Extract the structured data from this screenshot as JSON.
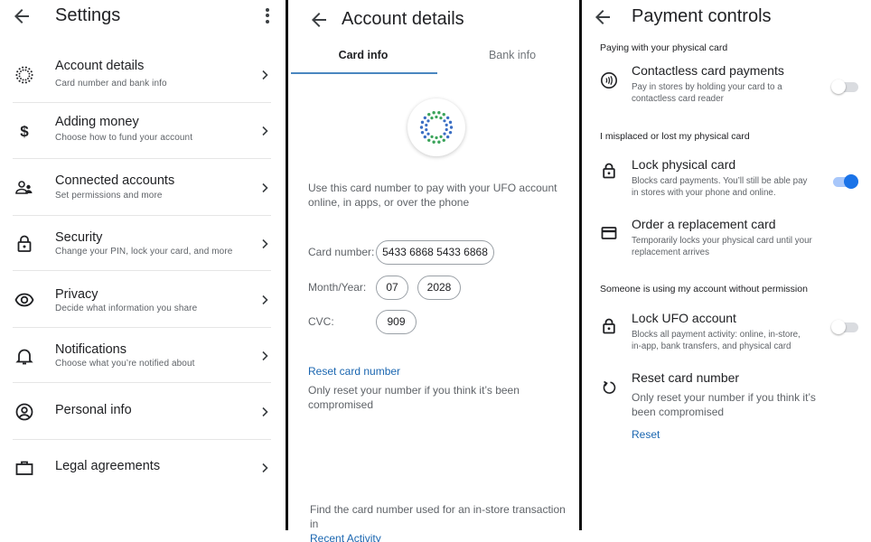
{
  "colors": {
    "link": "#1a66b0",
    "tab_indicator": "#4a86c0",
    "toggle_on": "#1a73e8",
    "logo_blue": "#3b6fc4",
    "logo_green": "#3aa35a"
  },
  "settings": {
    "title": "Settings",
    "back_icon": "arrow-left-icon",
    "more_icon": "more-vert-icon",
    "items": [
      {
        "icon": "ufo-logo-icon",
        "label": "Account details",
        "subtitle": "Card number and bank info"
      },
      {
        "icon": "dollar-icon",
        "label": "Adding money",
        "subtitle": "Choose how to fund your account"
      },
      {
        "icon": "people-icon",
        "label": "Connected accounts",
        "subtitle": "Set permissions and more"
      },
      {
        "icon": "lock-icon",
        "label": "Security",
        "subtitle": "Change your PIN, lock your card, and more"
      },
      {
        "icon": "eye-icon",
        "label": "Privacy",
        "subtitle": "Decide what information you share"
      },
      {
        "icon": "bell-icon",
        "label": "Notifications",
        "subtitle": "Choose what you’re notified about"
      },
      {
        "icon": "account-circle-icon",
        "label": "Personal info",
        "subtitle": ""
      },
      {
        "icon": "briefcase-icon",
        "label": "Legal agreements",
        "subtitle": ""
      }
    ]
  },
  "account_details": {
    "title": "Account details",
    "tabs": [
      {
        "label": "Card info",
        "active": true
      },
      {
        "label": "Bank info",
        "active": false
      }
    ],
    "description": "Use this card number to pay with your UFO account online, in apps, or over the phone",
    "fields": {
      "card_number_label": "Card number:",
      "card_number": "5433 6868 5433 6868",
      "month_year_label": "Month/Year:",
      "month": "07",
      "year": "2028",
      "cvc_label": "CVC:",
      "cvc": "909"
    },
    "reset_link": "Reset card number",
    "reset_note": "Only reset your number if you think it’s been compromised",
    "find_text": "Find the card number used for an in-store transaction in",
    "recent_activity_link": "Recent Activity"
  },
  "payment_controls": {
    "title": "Payment controls",
    "sections": [
      {
        "heading": "Paying with your physical card"
      },
      {
        "heading": "I misplaced or lost my physical card"
      },
      {
        "heading": "Someone is using my account without permission"
      }
    ],
    "controls": [
      {
        "icon": "contactless-icon",
        "label": "Contactless card payments",
        "subtitle": "Pay in stores by holding your card to a contactless card reader",
        "toggle": "off"
      },
      {
        "icon": "lock-icon",
        "label": "Lock physical card",
        "subtitle": "Blocks card payments. You’ll still be able pay in stores with your phone and online.",
        "toggle": "on"
      },
      {
        "icon": "credit-card-icon",
        "label": "Order a replacement card",
        "subtitle": "Temporarily locks your physical card until your replacement arrives"
      },
      {
        "icon": "lock-icon",
        "label": "Lock UFO account",
        "subtitle": "Blocks all payment activity: online, in-store, in-app, bank transfers, and physical card",
        "toggle": "off"
      },
      {
        "icon": "refresh-icon",
        "label": "Reset card number",
        "subtitle": "Only reset your number if you think it’s been compromised"
      }
    ],
    "reset_button": "Reset"
  }
}
